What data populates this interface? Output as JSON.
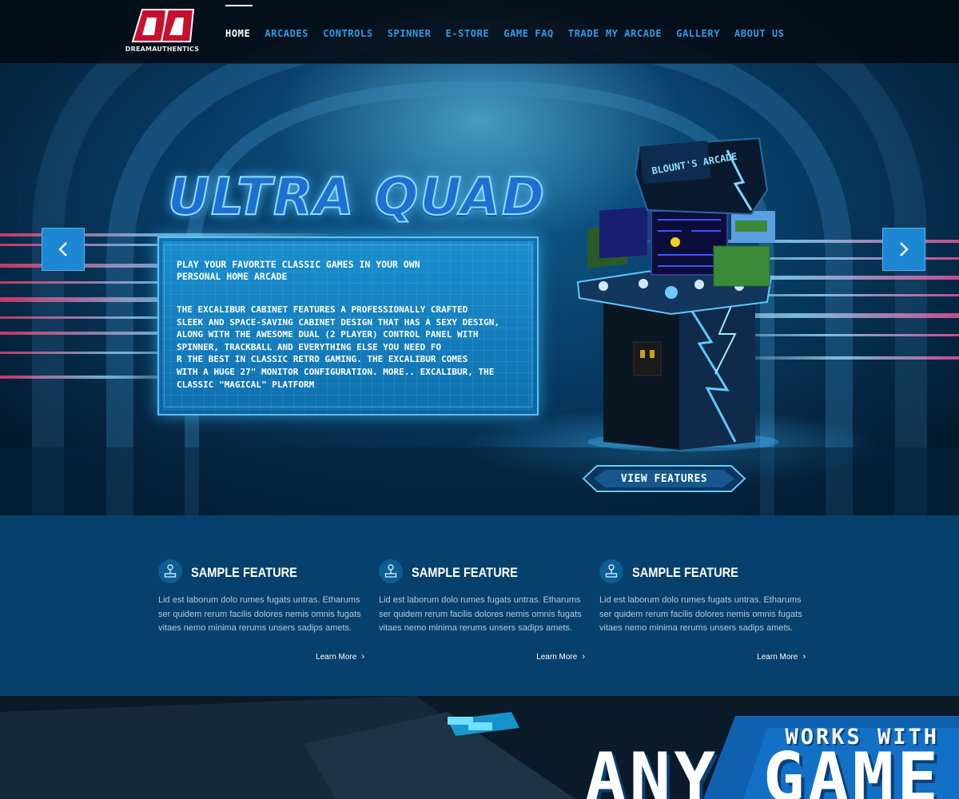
{
  "nav": {
    "logo_text": "DREAMAUTHENTICS",
    "logo_mark": "DA",
    "items": [
      {
        "label": "HOME",
        "active": true
      },
      {
        "label": "ARCADES",
        "active": false
      },
      {
        "label": "CONTROLS",
        "active": false
      },
      {
        "label": "SPINNER",
        "active": false
      },
      {
        "label": "E-STORE",
        "active": false
      },
      {
        "label": "GAME FAQ",
        "active": false
      },
      {
        "label": "TRADE MY ARCADE",
        "active": false
      },
      {
        "label": "GALLERY",
        "active": false
      },
      {
        "label": "ABOUT US",
        "active": false
      }
    ]
  },
  "hero": {
    "title": "ULTRA QUAD",
    "panel_heading": "PLAY YOUR FAVORITE CLASSIC GAMES IN YOUR OWN\nPERSONAL HOME ARCADE",
    "panel_body": "THE EXCALIBUR CABINET FEATURES A PROFESSIONALLY CRAFTED\nSLEEK AND SPACE-SAVING CABINET DESIGN THAT HAS A SEXY DESIGN,\nALONG WITH THE AWESOME DUAL (2 PLAYER) CONTROL PANEL WITH\nSPINNER, TRACKBALL AND EVERYTHING ELSE YOU NEED FO\nR THE BEST IN CLASSIC RETRO GAMING. THE EXCALIBUR COMES\nWITH A HUGE 27\" MONITOR CONFIGURATION. MORE.. EXCALIBUR, THE\nCLASSIC \"MAGICAL\" PLATFORM",
    "cabinet_marquee": "BLOUNT'S ARCADE",
    "cta": "VIEW FEATURES",
    "prev_icon": "chevron-left-icon",
    "next_icon": "chevron-right-icon"
  },
  "features": [
    {
      "icon": "joystick-icon",
      "title": "SAMPLE FEATURE",
      "text": "Lid est laborum dolo rumes fugats untras. Etharums ser quidem rerum facilis dolores nemis omnis fugats vitaes nemo minima rerums unsers sadips amets.",
      "link": "Learn More"
    },
    {
      "icon": "joystick-icon",
      "title": "SAMPLE FEATURE",
      "text": "Lid est laborum dolo rumes fugats untras. Etharums ser quidem rerum facilis dolores nemis omnis fugats vitaes nemo minima rerums unsers sadips amets.",
      "link": "Learn More"
    },
    {
      "icon": "joystick-icon",
      "title": "SAMPLE FEATURE",
      "text": "Lid est laborum dolo rumes fugats untras. Etharums ser quidem rerum facilis dolores nemis omnis fugats vitaes nemo minima rerums unsers sadips amets.",
      "link": "Learn More"
    }
  ],
  "banner": {
    "line1": "WORKS WITH",
    "line2": "ANY GAME"
  },
  "colors": {
    "nav_link": "#2f9be6",
    "nav_active": "#ffffff",
    "features_bg": "#06406c",
    "panel_bg": "#1a8fcf",
    "accent": "#1e87d4"
  }
}
